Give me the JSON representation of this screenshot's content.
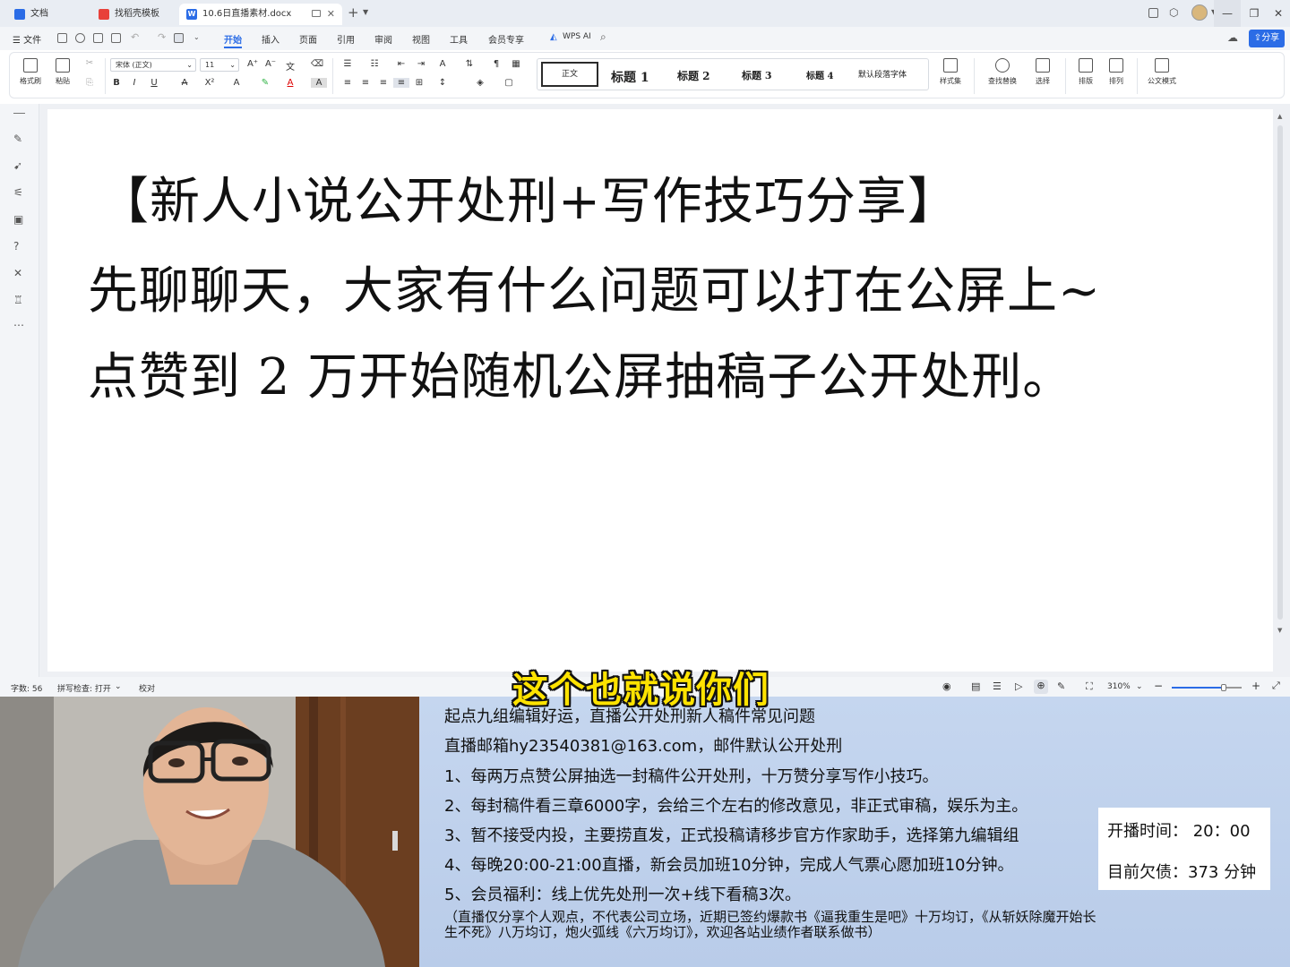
{
  "tabs": [
    {
      "label": "文档",
      "icon": "docs-home-icon",
      "color": "#2b6ce6"
    },
    {
      "label": "找稻壳模板",
      "icon": "docer-template-icon",
      "color": "#e8413a"
    },
    {
      "label": "10.6日直播素材.docx",
      "icon": "word-doc-icon",
      "color": "#2b6ce6"
    }
  ],
  "menu": {
    "file": "文件",
    "items": [
      "开始",
      "插入",
      "页面",
      "引用",
      "审阅",
      "视图",
      "工具",
      "会员专享"
    ],
    "active": "开始",
    "wps_ai": "WPS AI",
    "share": "分享"
  },
  "ribbon": {
    "format_painter": "格式刷",
    "paste": "粘贴",
    "font_name": "宋体 (正文)",
    "font_size": "11",
    "bold": "B",
    "italic": "I",
    "underline": "U",
    "styles": [
      "正文",
      "标题 1",
      "标题 2",
      "标题 3",
      "标题 4",
      "默认段落字体"
    ],
    "style_set": "样式集",
    "find_replace": "查找替换",
    "select": "选择",
    "layout": "排版",
    "arrange": "排列",
    "official_doc": "公文模式"
  },
  "document": {
    "title": "【新人小说公开处刑+写作技巧分享】",
    "line2": "先聊聊天，大家有什么问题可以打在公屏上~",
    "line3": "点赞到 2 万开始随机公屏抽稿子公开处刑。"
  },
  "statusbar": {
    "word_count": "字数: 56",
    "spell_check": "拼写检查: 打开",
    "proofread": "校对",
    "zoom": "310%",
    "zoom_fraction": 0.74
  },
  "subtitle": "这个也就说你们",
  "info_panel": {
    "lines": [
      "起点九组编辑好运，直播公开处刑新人稿件常见问题",
      "直播邮箱hy23540381@163.com，邮件默认公开处刑",
      "1、每两万点赞公屏抽选一封稿件公开处刑，十万赞分享写作小技巧。",
      "2、每封稿件看三章6000字，会给三个左右的修改意见，非正式审稿，娱乐为主。",
      "3、暂不接受内投，主要捞直发，正式投稿请移步官方作家助手，选择第九编辑组",
      "4、每晚20:00-21:00直播，新会员加班10分钟，完成人气票心愿加班10分钟。",
      "5、会员福利：线上优先处刑一次+线下看稿3次。"
    ],
    "note": "（直播仅分享个人观点，不代表公司立场，近期已签约爆款书《逼我重生是吧》十万均订，《从斩妖除魔开始长生不死》八万均订，炮火弧线《六万均订》，欢迎各站业绩作者联系做书）",
    "start_time": "开播时间：  20：00",
    "debt": "目前欠债：373 分钟"
  },
  "colors": {
    "accent": "#2b6ce6",
    "subtitle_fill": "#ffe300",
    "panel_bg": "#c5d6ef"
  }
}
